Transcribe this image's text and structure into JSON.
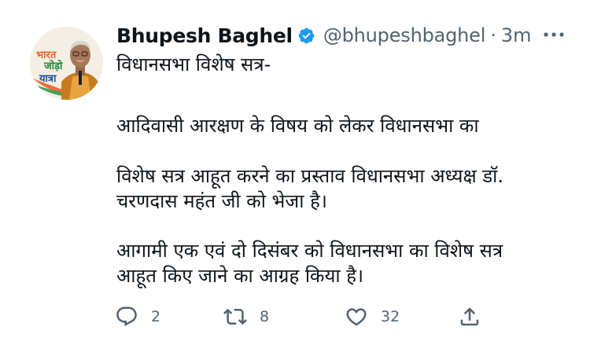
{
  "author": {
    "name": "Bhupesh Baghel",
    "handle": "@bhupeshbaghel",
    "separator": "·",
    "time": "3m",
    "avatar_logo_lines": [
      "भारत",
      "जोड़ो",
      "यात्रा"
    ]
  },
  "tweet": {
    "lines": [
      "विधानसभा विशेष सत्र-",
      "आदिवासी आरक्षण के विषय को लेकर विधानसभा का",
      "विशेष सत्र आहूत करने का प्रस्ताव विधानसभा अध्यक्ष डॉ.",
      "चरणदास महंत जी को भेजा है।",
      "आगामी एक एवं दो दिसंबर को विधानसभा का विशेष सत्र",
      "आहूत किए जाने का आग्रह किया है।"
    ]
  },
  "actions": {
    "replies": "2",
    "retweets": "8",
    "likes": "32"
  },
  "icons": {
    "verified": "verified-badge-icon",
    "more": "more-options-icon",
    "reply": "reply-icon",
    "retweet": "retweet-icon",
    "like": "heart-icon",
    "share": "share-icon"
  },
  "colors": {
    "text_primary": "#0f1419",
    "text_secondary": "#536471",
    "verified_blue": "#1d9bf0"
  }
}
